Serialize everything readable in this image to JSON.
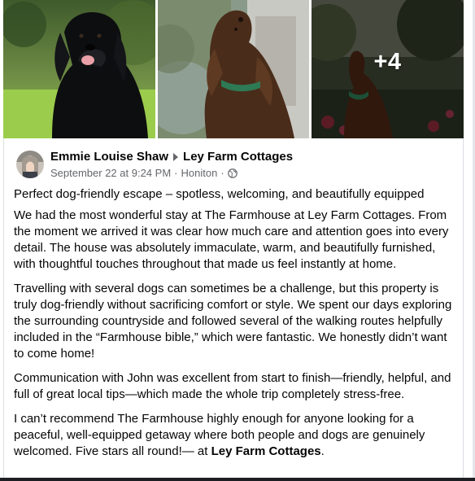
{
  "gallery": {
    "more_count": "+4",
    "photos": [
      {
        "icon": "black-dog-photo"
      },
      {
        "icon": "brown-spaniel-photo"
      },
      {
        "icon": "dog-in-garden-photo"
      }
    ]
  },
  "post": {
    "author": "Emmie Louise Shaw",
    "target": "Ley Farm Cottages",
    "date": "September 22 at 9:24 PM",
    "separator": "·",
    "location": "Honiton",
    "privacy_icon": "globe-icon",
    "headline": "Perfect dog-friendly escape – spotless, welcoming, and beautifully equipped",
    "paragraphs": [
      "We had the most wonderful stay at The Farmhouse at Ley Farm Cottages. From the moment we arrived it was clear how much care and attention goes into every detail. The house was absolutely immaculate, warm, and beautifully furnished, with thoughtful touches throughout that made us feel instantly at home.",
      "Travelling with several dogs can sometimes be a challenge, but this property is truly dog-friendly without sacrificing comfort or style. We spent our days exploring the surrounding countryside and followed several of the walking routes helpfully included in the “Farmhouse bible,” which were fantastic. We honestly didn’t want to come home!",
      "Communication with John was excellent from start to finish—friendly, helpful, and full of great local tips—which made the whole trip completely stress-free."
    ],
    "closing": "I can’t recommend The Farmhouse highly enough for anyone looking for a peaceful, well-equipped getaway where both people and dogs are genuinely welcomed. Five stars all round!— at ",
    "closing_place": "Ley Farm Cottages",
    "closing_end": "."
  }
}
